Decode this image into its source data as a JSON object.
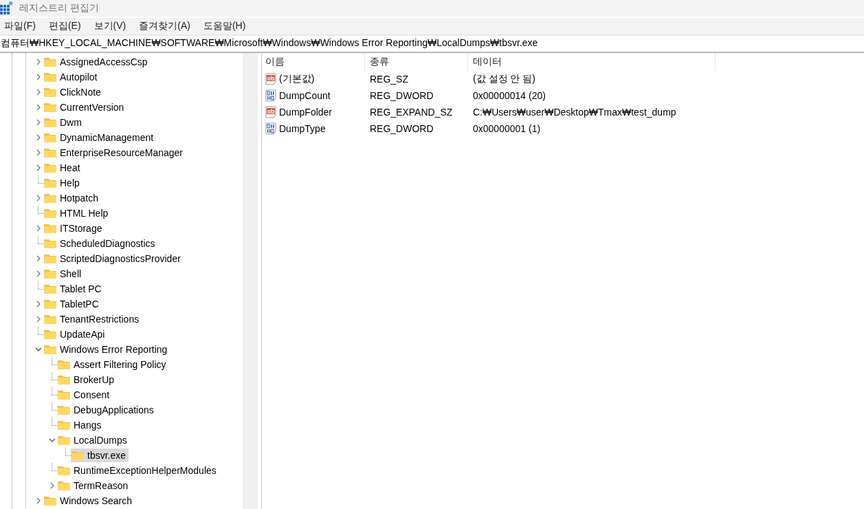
{
  "window": {
    "title": "레지스트리 편집기"
  },
  "menu": [
    {
      "label": "파일(F)"
    },
    {
      "label": "편집(E)"
    },
    {
      "label": "보기(V)"
    },
    {
      "label": "즐겨찾기(A)"
    },
    {
      "label": "도움말(H)"
    }
  ],
  "address": {
    "value": "컴퓨터₩HKEY_LOCAL_MACHINE₩SOFTWARE₩Microsoft₩Windows₩Windows Error Reporting₩LocalDumps₩tbsvr.exe"
  },
  "tree": [
    {
      "label": "AssignedAccessCsp",
      "kind": "expandable",
      "expanded": false,
      "selected": false
    },
    {
      "label": "Autopilot",
      "kind": "expandable",
      "expanded": false,
      "selected": false
    },
    {
      "label": "ClickNote",
      "kind": "expandable",
      "expanded": false,
      "selected": false
    },
    {
      "label": "CurrentVersion",
      "kind": "expandable",
      "expanded": false,
      "selected": false
    },
    {
      "label": "Dwm",
      "kind": "expandable",
      "expanded": false,
      "selected": false
    },
    {
      "label": "DynamicManagement",
      "kind": "expandable",
      "expanded": false,
      "selected": false
    },
    {
      "label": "EnterpriseResourceManager",
      "kind": "expandable",
      "expanded": false,
      "selected": false
    },
    {
      "label": "Heat",
      "kind": "expandable",
      "expanded": false,
      "selected": false
    },
    {
      "label": "Help",
      "kind": "leaf",
      "selected": false
    },
    {
      "label": "Hotpatch",
      "kind": "expandable",
      "expanded": false,
      "selected": false
    },
    {
      "label": "HTML Help",
      "kind": "leaf",
      "selected": false
    },
    {
      "label": "ITStorage",
      "kind": "expandable",
      "expanded": false,
      "selected": false
    },
    {
      "label": "ScheduledDiagnostics",
      "kind": "leaf",
      "selected": false
    },
    {
      "label": "ScriptedDiagnosticsProvider",
      "kind": "expandable",
      "expanded": false,
      "selected": false
    },
    {
      "label": "Shell",
      "kind": "expandable",
      "expanded": false,
      "selected": false
    },
    {
      "label": "Tablet PC",
      "kind": "leaf",
      "selected": false
    },
    {
      "label": "TabletPC",
      "kind": "expandable",
      "expanded": false,
      "selected": false
    },
    {
      "label": "TenantRestrictions",
      "kind": "expandable",
      "expanded": false,
      "selected": false
    },
    {
      "label": "UpdateApi",
      "kind": "leaf",
      "selected": false
    },
    {
      "label": "Windows Error Reporting",
      "kind": "expandable",
      "expanded": true,
      "selected": false,
      "children": [
        {
          "label": "Assert Filtering Policy",
          "kind": "leaf",
          "selected": false
        },
        {
          "label": "BrokerUp",
          "kind": "leaf",
          "selected": false
        },
        {
          "label": "Consent",
          "kind": "leaf",
          "selected": false
        },
        {
          "label": "DebugApplications",
          "kind": "leaf",
          "selected": false
        },
        {
          "label": "Hangs",
          "kind": "leaf",
          "selected": false
        },
        {
          "label": "LocalDumps",
          "kind": "expandable",
          "expanded": true,
          "selected": false,
          "children": [
            {
              "label": "tbsvr.exe",
              "kind": "leaf",
              "selected": true
            }
          ]
        },
        {
          "label": "RuntimeExceptionHelperModules",
          "kind": "leaf",
          "selected": false
        },
        {
          "label": "TermReason",
          "kind": "expandable",
          "expanded": false,
          "selected": false
        }
      ]
    },
    {
      "label": "Windows Search",
      "kind": "expandable",
      "expanded": false,
      "selected": false
    }
  ],
  "values": {
    "columns": [
      "이름",
      "종류",
      "데이터"
    ],
    "rows": [
      {
        "name": "(기본값)",
        "kind": "string",
        "type": "REG_SZ",
        "data": "(값 설정 안 됨)"
      },
      {
        "name": "DumpCount",
        "kind": "binary",
        "type": "REG_DWORD",
        "data": "0x00000014 (20)"
      },
      {
        "name": "DumpFolder",
        "kind": "string",
        "type": "REG_EXPAND_SZ",
        "data": "C:₩Users₩user₩Desktop₩Tmax₩test_dump"
      },
      {
        "name": "DumpType",
        "kind": "binary",
        "type": "REG_DWORD",
        "data": "0x00000001 (1)"
      }
    ]
  }
}
